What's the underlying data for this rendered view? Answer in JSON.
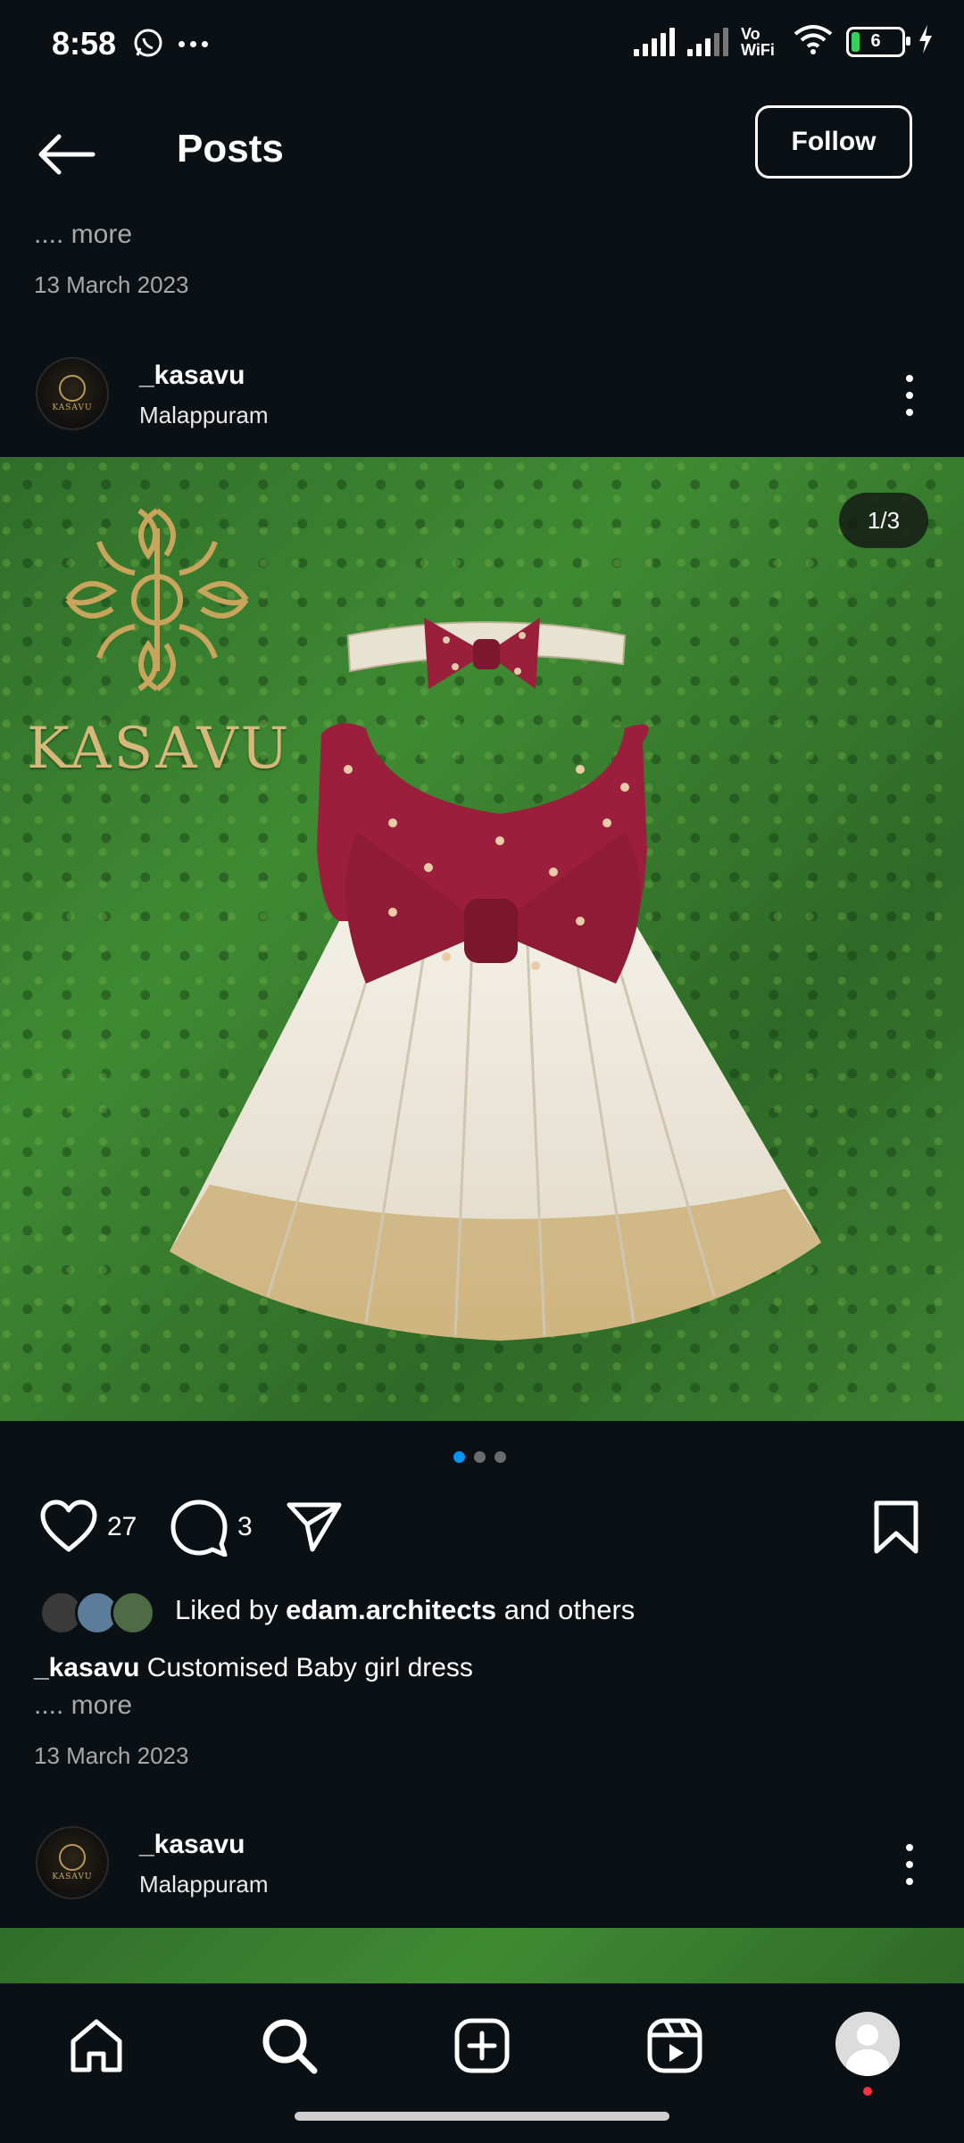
{
  "status_bar": {
    "time": "8:58",
    "volte": "Vo WiFi",
    "battery_level": "6"
  },
  "header": {
    "title": "Posts",
    "follow_label": "Follow"
  },
  "previous_post": {
    "more_label": ".... more",
    "date": "13 March 2023"
  },
  "post": {
    "username": "_kasavu",
    "location": "Malappuram",
    "image_counter": "1/3",
    "brand_watermark": "KASAVU",
    "carousel_dots": 3,
    "carousel_active": 0,
    "likes": "27",
    "comments": "3",
    "liked_by_prefix": "Liked by",
    "liked_by_user": "edam.architects",
    "liked_by_suffix": "and others",
    "caption_user": "_kasavu",
    "caption_text": "Customised Baby girl dress",
    "more_label": ".... more",
    "date": "13 March 2023"
  },
  "next_post": {
    "username": "_kasavu",
    "location": "Malappuram"
  },
  "bottom_nav": {
    "items": [
      "home-icon",
      "search-icon",
      "create-icon",
      "reels-icon",
      "profile-icon"
    ]
  },
  "colors": {
    "background": "#0b1014",
    "accent": "#0095f6",
    "notification": "#ff3040",
    "brand_gold": "#d6b87a"
  }
}
